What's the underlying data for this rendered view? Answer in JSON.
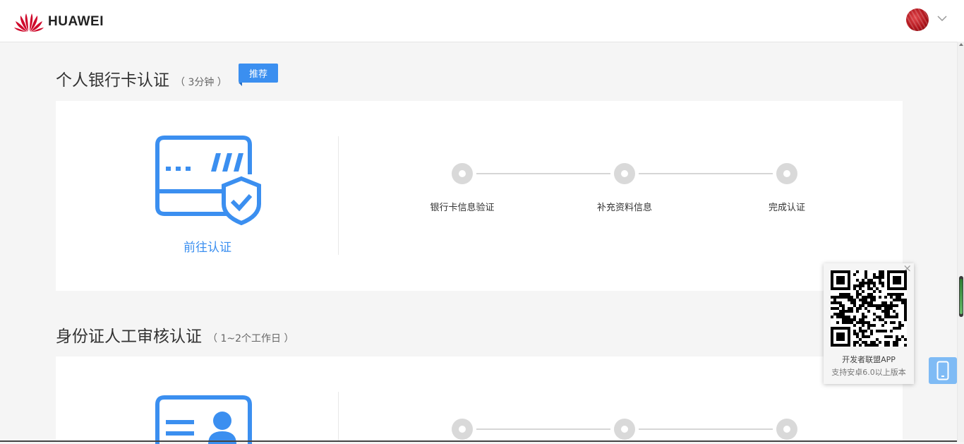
{
  "header": {
    "brand": "HUAWEI",
    "brand_color": "#cf0a2c",
    "avatar_icon": "user-avatar",
    "menu_icon": "chevron-down-icon"
  },
  "sections": [
    {
      "title": "个人银行卡认证",
      "duration": "（ 3分钟 ）",
      "badge": "推荐",
      "icon": "bank-card-shield-icon",
      "link": "前往认证",
      "steps": [
        "银行卡信息验证",
        "补充资料信息",
        "完成认证"
      ]
    },
    {
      "title": "身份证人工审核认证",
      "duration": "（ 1~2个工作日 ）",
      "icon": "id-card-icon",
      "steps": [
        "",
        "",
        ""
      ]
    }
  ],
  "qr_popup": {
    "close_label": "×",
    "title": "开发者联盟APP",
    "subtitle": "支持安卓6.0以上版本"
  },
  "accent_color": "#3b8ff0",
  "phone_button_icon": "mobile-phone-icon"
}
